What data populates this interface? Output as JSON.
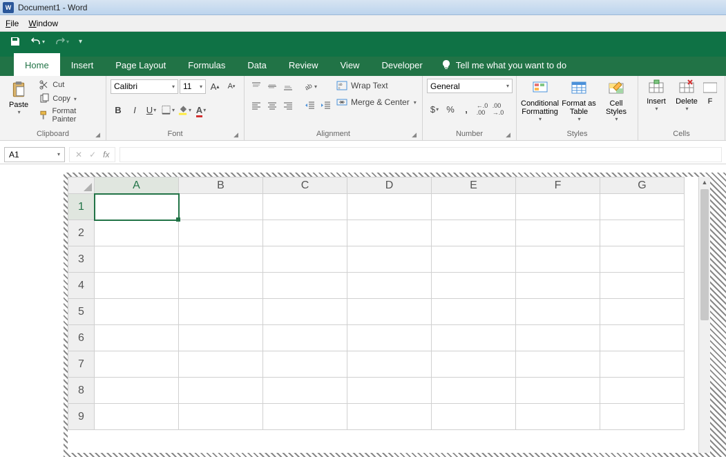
{
  "title": "Document1 - Word",
  "wordmenu": {
    "file": "File",
    "window": "Window"
  },
  "tabs": [
    "Home",
    "Insert",
    "Page Layout",
    "Formulas",
    "Data",
    "Review",
    "View",
    "Developer"
  ],
  "active_tab": "Home",
  "tellme": "Tell me what you want to do",
  "ribbon": {
    "clipboard": {
      "paste": "Paste",
      "cut": "Cut",
      "copy": "Copy",
      "format_painter": "Format Painter",
      "label": "Clipboard"
    },
    "font": {
      "name": "Calibri",
      "size": "11",
      "label": "Font"
    },
    "alignment": {
      "wrap": "Wrap Text",
      "merge": "Merge & Center",
      "label": "Alignment"
    },
    "number": {
      "format": "General",
      "label": "Number"
    },
    "styles": {
      "cond": "Conditional Formatting",
      "table": "Format as Table",
      "cell": "Cell Styles",
      "label": "Styles"
    },
    "cells": {
      "insert": "Insert",
      "delete": "Delete",
      "label": "Cells"
    }
  },
  "namebox": "A1",
  "columns": [
    "A",
    "B",
    "C",
    "D",
    "E",
    "F",
    "G"
  ],
  "rows": [
    "1",
    "2",
    "3",
    "4",
    "5",
    "6",
    "7",
    "8",
    "9"
  ],
  "selected_cell": "A1"
}
